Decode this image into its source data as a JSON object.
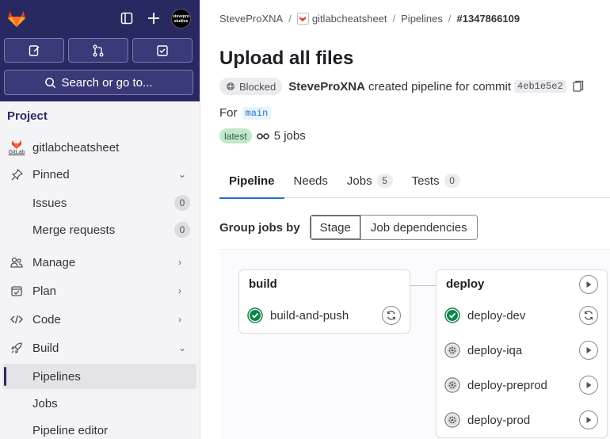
{
  "sidebar": {
    "avatar_text": "stevepro studios",
    "search_label": "Search or go to...",
    "section_title": "Project",
    "project_name": "gitlabcheatsheet",
    "project_avatar_text": "GitLab",
    "items": [
      {
        "label": "Pinned"
      },
      {
        "label": "Issues",
        "count": "0"
      },
      {
        "label": "Merge requests",
        "count": "0"
      },
      {
        "label": "Manage"
      },
      {
        "label": "Plan"
      },
      {
        "label": "Code"
      },
      {
        "label": "Build"
      },
      {
        "label": "Pipelines"
      },
      {
        "label": "Jobs"
      },
      {
        "label": "Pipeline editor"
      }
    ]
  },
  "breadcrumb": {
    "owner": "SteveProXNA",
    "project": "gitlabcheatsheet",
    "section": "Pipelines",
    "current": "#1347866109"
  },
  "pipeline": {
    "title": "Upload all files",
    "status": "Blocked",
    "author": "SteveProXNA",
    "created_text": "created pipeline for commit",
    "commit": "4eb1e5e2",
    "for_label": "For",
    "branch": "main",
    "latest_badge": "latest",
    "jobs_summary": "5 jobs"
  },
  "tabs": [
    {
      "label": "Pipeline"
    },
    {
      "label": "Needs"
    },
    {
      "label": "Jobs",
      "count": "5"
    },
    {
      "label": "Tests",
      "count": "0"
    }
  ],
  "group_by": {
    "label": "Group jobs by",
    "options": [
      "Stage",
      "Job dependencies"
    ],
    "selected": "Stage"
  },
  "stages": [
    {
      "name": "build",
      "jobs": [
        {
          "name": "build-and-push",
          "status": "success",
          "action": "retry"
        }
      ]
    },
    {
      "name": "deploy",
      "jobs": [
        {
          "name": "deploy-dev",
          "status": "success",
          "action": "retry"
        },
        {
          "name": "deploy-iqa",
          "status": "manual",
          "action": "play"
        },
        {
          "name": "deploy-preprod",
          "status": "manual",
          "action": "play"
        },
        {
          "name": "deploy-prod",
          "status": "manual",
          "action": "play"
        }
      ]
    }
  ],
  "colors": {
    "sidebar_header": "#292961",
    "success": "#108548",
    "active_tab": "#1f75cb",
    "latest_badge_bg": "#c3e6cd"
  }
}
